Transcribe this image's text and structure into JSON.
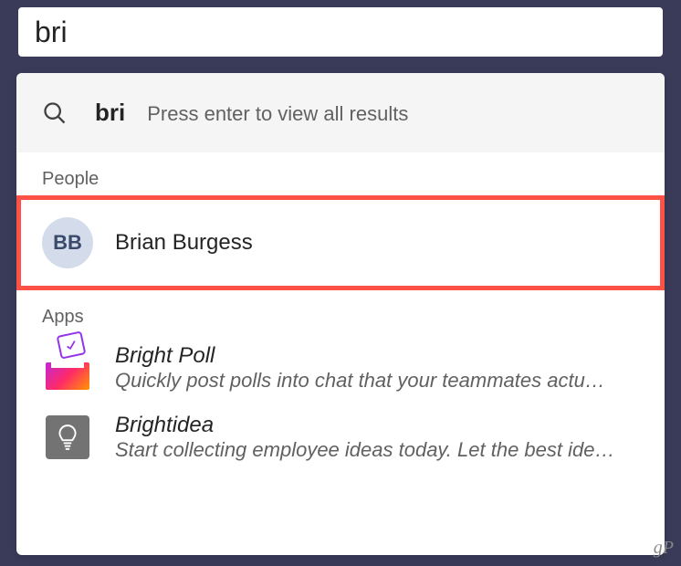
{
  "search": {
    "value": "bri",
    "term": "bri",
    "hint": "Press enter to view all results"
  },
  "sections": {
    "people": {
      "header": "People",
      "items": [
        {
          "initials": "BB",
          "name": "Brian Burgess"
        }
      ]
    },
    "apps": {
      "header": "Apps",
      "items": [
        {
          "name": "Bright Poll",
          "subtitle": "Quickly post polls into chat that your teammates actu…"
        },
        {
          "name": "Brightidea",
          "subtitle": "Start collecting employee ideas today. Let the best ide…"
        }
      ]
    }
  },
  "watermark": "gP"
}
